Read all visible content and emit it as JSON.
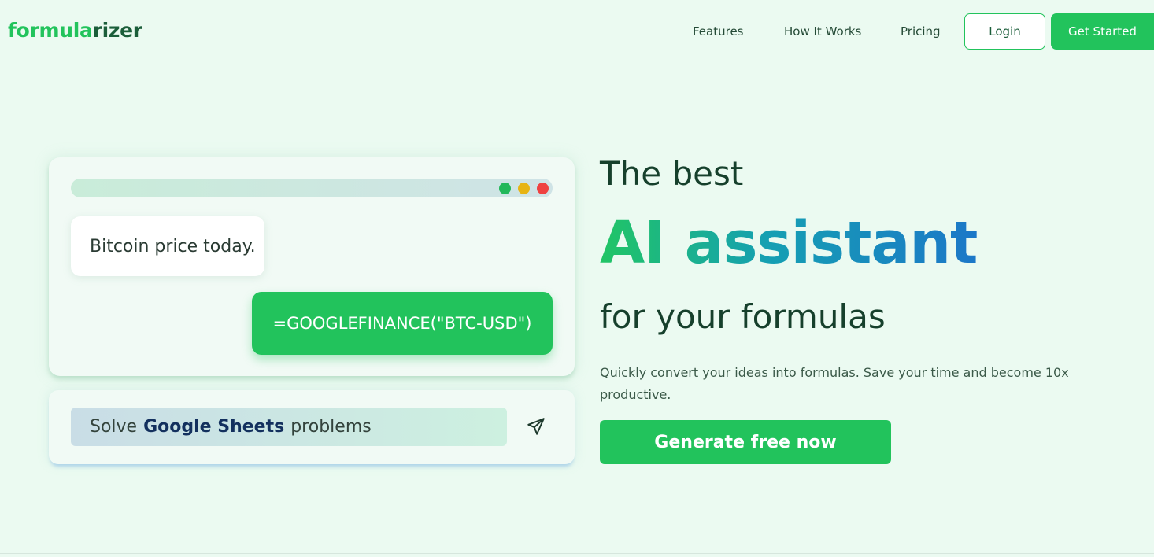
{
  "header": {
    "logo_main": "formula",
    "logo_accent": "rizer",
    "nav": [
      "Features",
      "How It Works",
      "Pricing"
    ],
    "login_label": "Login",
    "get_started_label": "Get Started"
  },
  "demo": {
    "user_message": "Bitcoin price today.",
    "formula_reply": "=GOOGLEFINANCE(\"BTC-USD\")",
    "window_dots": [
      "green",
      "yellow",
      "red"
    ]
  },
  "prompt": {
    "prefix": "Solve",
    "highlight": "Google Sheets",
    "suffix": "problems",
    "send_icon": "send-icon"
  },
  "hero": {
    "line1": "The best",
    "headline": "AI assistant",
    "line2": "for your formulas",
    "description": "Quickly convert your ideas into formulas. Save your time and become 10x productive.",
    "cta_label": "Generate free now"
  },
  "colors": {
    "brand_green": "#22c35c",
    "dark_green": "#16402c",
    "background": "#ebfaf1",
    "gradient_blue": "#1c77c8"
  }
}
